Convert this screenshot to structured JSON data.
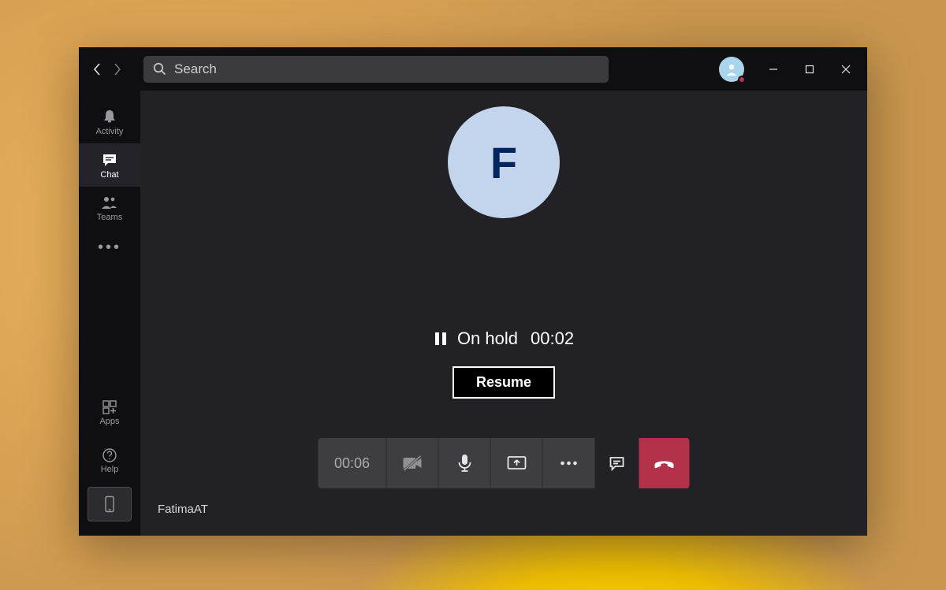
{
  "search": {
    "placeholder": "Search"
  },
  "sidebar": {
    "items": [
      {
        "label": "Activity"
      },
      {
        "label": "Chat"
      },
      {
        "label": "Teams"
      }
    ],
    "apps_label": "Apps",
    "help_label": "Help"
  },
  "call": {
    "avatar_initial": "F",
    "hold_status": "On hold",
    "hold_timer": "00:02",
    "resume_label": "Resume",
    "call_timer": "00:06",
    "participant_name": "FatimaAT"
  }
}
